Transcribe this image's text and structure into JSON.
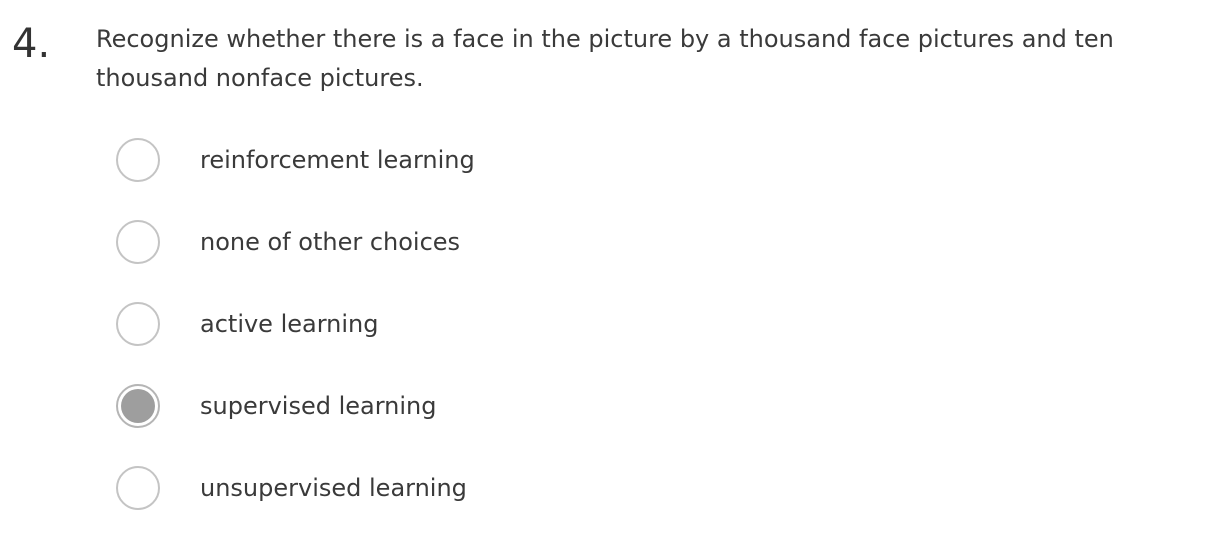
{
  "question": {
    "number": "4.",
    "text": "Recognize whether there is a face in the picture by a thousand face pictures and ten thousand nonface pictures."
  },
  "options": [
    {
      "label": "reinforcement learning",
      "selected": false
    },
    {
      "label": "none of other choices",
      "selected": false
    },
    {
      "label": "active learning",
      "selected": false
    },
    {
      "label": "supervised learning",
      "selected": true
    },
    {
      "label": "unsupervised learning",
      "selected": false
    }
  ],
  "colors": {
    "radio_border": "#c4c4c4",
    "radio_selected_fill": "#9e9e9e",
    "text": "#3a3a3a"
  }
}
